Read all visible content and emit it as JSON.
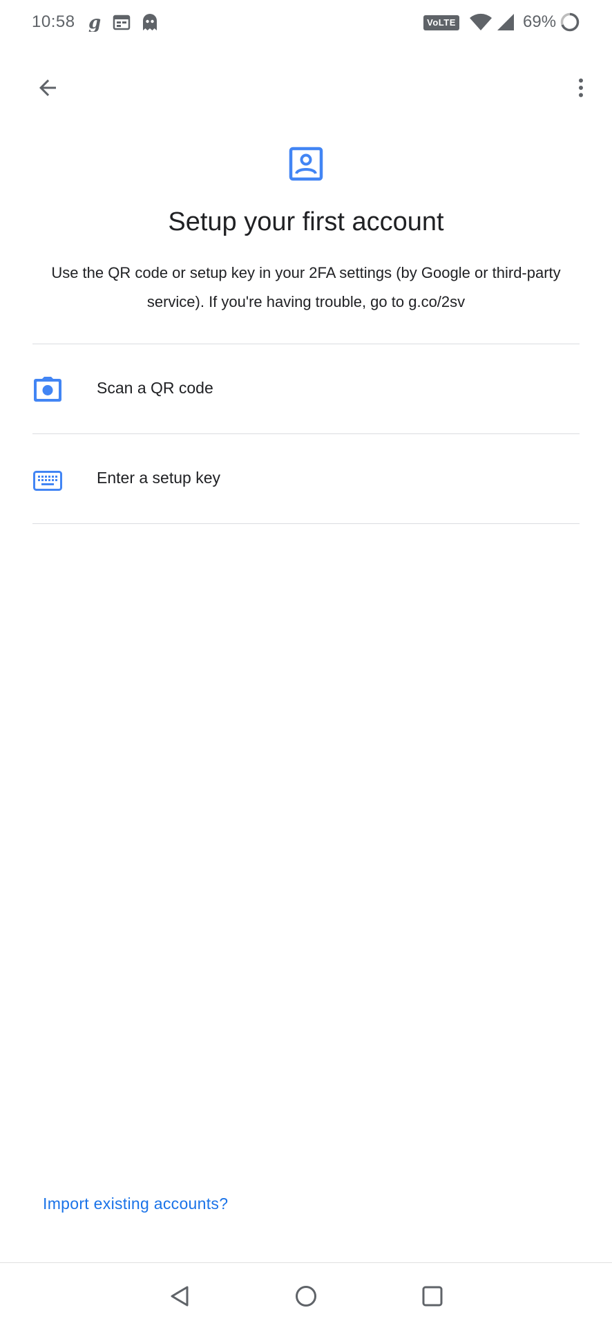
{
  "status_bar": {
    "time": "10:58",
    "volte_label": "VoLTE",
    "battery_percent": "69%",
    "icons": [
      "g-icon",
      "calendar-icon",
      "ghost-icon",
      "wifi-icon",
      "signal-icon",
      "battery-ring-icon"
    ]
  },
  "app_bar": {
    "back_icon": "arrow-back-icon",
    "more_icon": "more-vert-icon"
  },
  "header": {
    "icon": "account-box-icon",
    "title": "Setup your first account",
    "description": "Use the QR code or setup key in your 2FA settings (by Google or third-party service). If you're having trouble, go to g.co/2sv"
  },
  "options": [
    {
      "icon": "camera-icon",
      "label": "Scan a QR code"
    },
    {
      "icon": "keyboard-icon",
      "label": "Enter a setup key"
    }
  ],
  "footer": {
    "import_link": "Import existing accounts?"
  },
  "nav_bar": {
    "buttons": [
      "back-triangle-icon",
      "home-circle-icon",
      "recents-square-icon"
    ]
  },
  "colors": {
    "accent": "#4285f4",
    "link": "#1a73e8",
    "text": "#202124",
    "muted": "#5f6368",
    "divider": "#dadce0"
  }
}
